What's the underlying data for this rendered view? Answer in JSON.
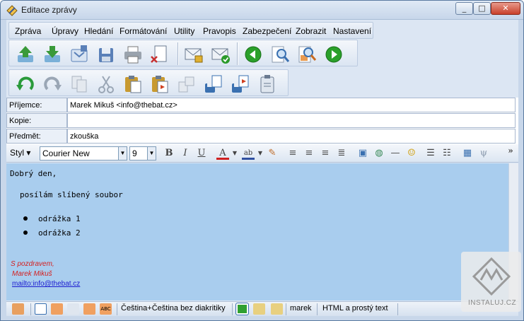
{
  "window": {
    "title": "Editace zprávy"
  },
  "menu": [
    "Zpráva",
    "Úpravy",
    "Hledání",
    "Formátování",
    "Utility",
    "Pravopis",
    "Zabezpečení",
    "Zobrazit",
    "Nastavení"
  ],
  "toolbar1": [
    {
      "name": "send-icon",
      "color": "#3a9a3a"
    },
    {
      "name": "save-outbox-icon",
      "color": "#3a9a3a"
    },
    {
      "name": "queue-icon",
      "color": "#5a80b8"
    },
    {
      "name": "save-draft-icon",
      "color": "#5a80b8"
    },
    {
      "name": "print-icon",
      "color": "#6a6a6a"
    },
    {
      "name": "discard-icon",
      "color": "#c83030"
    },
    {
      "name": "envelope-lock-icon",
      "color": "#6a7a90"
    },
    {
      "name": "envelope-check-icon",
      "color": "#2a9a2a"
    },
    {
      "name": "prev-icon",
      "color": "#2aa02a"
    },
    {
      "name": "find-icon",
      "color": "#3a70b0"
    },
    {
      "name": "find-replace-icon",
      "color": "#c86a20"
    },
    {
      "name": "next-icon",
      "color": "#2aa02a"
    }
  ],
  "toolbar2": [
    {
      "name": "undo-icon",
      "color": "#2a9a3a"
    },
    {
      "name": "redo-icon",
      "color": "#9aa6b5"
    },
    {
      "name": "copy-disabled-icon",
      "color": "#9aa6b5"
    },
    {
      "name": "cut-icon",
      "color": "#9aa6b5"
    },
    {
      "name": "paste-icon",
      "color": "#c89a30"
    },
    {
      "name": "paste-special-icon",
      "color": "#c89a30"
    },
    {
      "name": "quote-disabled-icon",
      "color": "#9aa6b5"
    },
    {
      "name": "attach-icon",
      "color": "#3a70b0"
    },
    {
      "name": "attach-send-icon",
      "color": "#3a70b0"
    },
    {
      "name": "clipboard-icon",
      "color": "#6a7a90"
    }
  ],
  "fields": {
    "to_label": "Příjemce:",
    "to_value": "Marek Mikuš <info@thebat.cz>",
    "cc_label": "Kopie:",
    "cc_value": "",
    "subject_label": "Předmět:",
    "subject_value": "zkouška"
  },
  "format": {
    "style_label": "Styl",
    "font": "Courier New",
    "size": "9",
    "more": "»"
  },
  "body": {
    "greeting": "Dobrý den,",
    "line1": "posílám slíbený soubor",
    "bullet1": "odrážka 1",
    "bullet2": "odrážka 2",
    "sig1": "S pozdravem,",
    "sig2": "Marek Mikuš",
    "sig_link": "mailto:info@thebat.cz"
  },
  "status": {
    "language": "Čeština+Čeština bez diakritiky",
    "account": "marek",
    "mode": "HTML a prostý text"
  },
  "watermark": "INSTALUJ.CZ"
}
